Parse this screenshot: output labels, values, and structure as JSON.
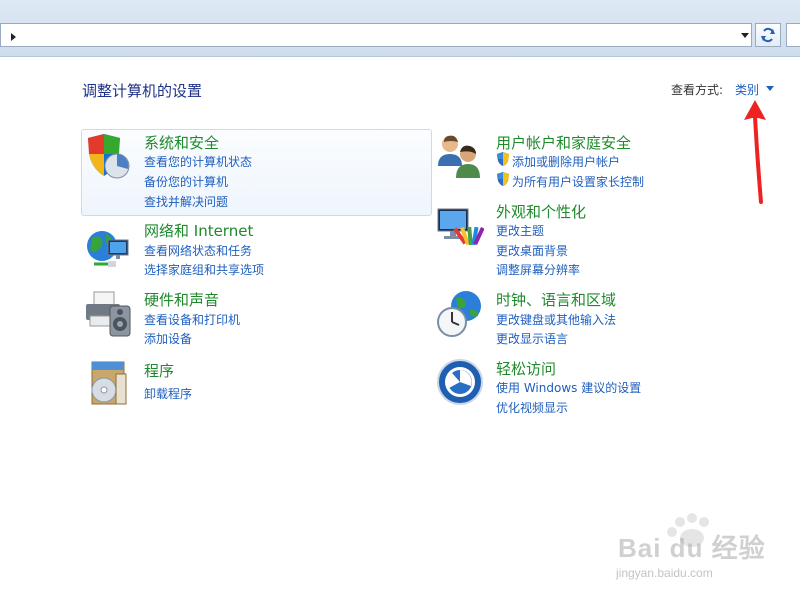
{
  "header": {
    "title": "调整计算机的设置",
    "view_by_label": "查看方式:",
    "view_by_value": "类别"
  },
  "categories": [
    {
      "id": "system",
      "title": "系统和安全",
      "icon": "shield-pie-icon",
      "links": [
        "查看您的计算机状态",
        "备份您的计算机",
        "查找并解决问题"
      ]
    },
    {
      "id": "network",
      "title": "网络和 Internet",
      "icon": "globe-network-icon",
      "links": [
        "查看网络状态和任务",
        "选择家庭组和共享选项"
      ]
    },
    {
      "id": "hardware",
      "title": "硬件和声音",
      "icon": "printer-speaker-icon",
      "links": [
        "查看设备和打印机",
        "添加设备"
      ]
    },
    {
      "id": "programs",
      "title": "程序",
      "icon": "program-box-icon",
      "links": [
        "卸载程序"
      ]
    },
    {
      "id": "users",
      "title": "用户帐户和家庭安全",
      "icon": "users-icon",
      "links": [
        "添加或删除用户帐户",
        "为所有用户设置家长控制"
      ]
    },
    {
      "id": "appearance",
      "title": "外观和个性化",
      "icon": "monitor-palette-icon",
      "links": [
        "更改主题",
        "更改桌面背景",
        "调整屏幕分辨率"
      ]
    },
    {
      "id": "clock",
      "title": "时钟、语言和区域",
      "icon": "clock-globe-icon",
      "links": [
        "更改键盘或其他输入法",
        "更改显示语言"
      ]
    },
    {
      "id": "ease",
      "title": "轻松访问",
      "icon": "ease-of-access-icon",
      "links": [
        "使用 Windows 建议的设置",
        "优化视频显示"
      ]
    }
  ],
  "watermark": {
    "brand": "Bai du 经验",
    "url": "jingyan.baidu.com"
  },
  "colors": {
    "title_green": "#1e8a2c",
    "link_blue": "#1f5fbf",
    "heading_blue": "#1e3287",
    "annotation_red": "#ee2222"
  }
}
